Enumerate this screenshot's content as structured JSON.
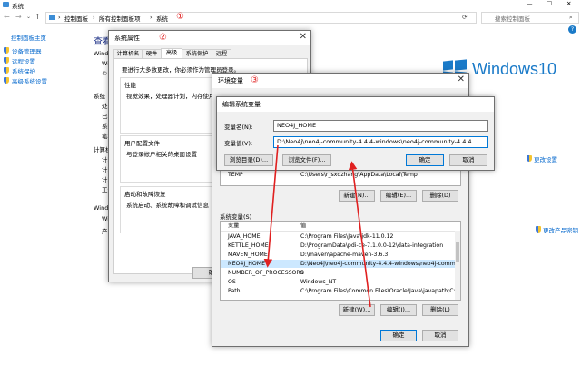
{
  "explorer": {
    "title": "系统",
    "controls": {
      "min": "—",
      "max": "☐",
      "close": "✕"
    },
    "breadcrumb": [
      "控制面板",
      "所有控制面板项",
      "系统"
    ],
    "breadcrumb_sep": "›",
    "annotation": "①",
    "search_placeholder": "搜索控制面板",
    "sidebar": {
      "home": "控制面板主页",
      "items": [
        "设备管理器",
        "远程设置",
        "系统保护",
        "高级系统设置"
      ]
    },
    "main_heading": "查看有关",
    "partial_labels": {
      "windows": "Windo",
      "win1": "Win",
      "win2": "©",
      "system": "系统",
      "sys1": "处理",
      "sys2": "已安",
      "sys3": "系统",
      "sys4": "笔和",
      "computer": "计算机",
      "comp1": "计算",
      "comp2": "计算",
      "comp3": "计算",
      "comp4": "工作",
      "winact": "Windo",
      "winact1": "Win",
      "winact2": "产品"
    },
    "brand": "Windows10",
    "change_settings": "更改设置",
    "change_key": "更改产品密钥",
    "help_icon": "?"
  },
  "sysprops": {
    "title": "系统属性",
    "annotation": "②",
    "tabs": [
      "计算机名",
      "硬件",
      "高级",
      "系统保护",
      "远程"
    ],
    "active_tab": 2,
    "admin_note": "要进行大多数更改，你必须作为管理员登录。",
    "performance": {
      "title": "性能",
      "desc": "视觉效果，处理器计划，内存使用，以"
    },
    "profiles": {
      "title": "用户配置文件",
      "desc": "与登录帐户相关的桌面设置"
    },
    "startup": {
      "title": "启动和故障恢复",
      "desc": "系统启动、系统故障和调试信息"
    },
    "partial_button": "确"
  },
  "envvars": {
    "title": "环境变量",
    "annotation": "③",
    "user_row": {
      "name": "TEMP",
      "value": "C:\\Users\\r_sxdzhang\\AppData\\Local\\Temp"
    },
    "user_buttons": [
      "新建(N)...",
      "编辑(E)...",
      "删除(D)"
    ],
    "system_section": "系统变量(S)",
    "columns": [
      "变量",
      "值"
    ],
    "system_rows": [
      {
        "name": "JAVA_HOME",
        "value": "C:\\Program Files\\Java\\jdk-11.0.12"
      },
      {
        "name": "KETTLE_HOME",
        "value": "D:\\ProgramData\\pdi-ce-7.1.0.0-12\\data-integration"
      },
      {
        "name": "MAVEN_HOME",
        "value": "D:\\maven\\apache-maven-3.6.3"
      },
      {
        "name": "NEO4J_HOME",
        "value": "D:\\Neo4j\\neo4j-community-4.4.4-windows\\neo4j-community-..."
      },
      {
        "name": "NUMBER_OF_PROCESSORS",
        "value": "8"
      },
      {
        "name": "OS",
        "value": "Windows_NT"
      },
      {
        "name": "Path",
        "value": "C:\\Program Files\\Common Files\\Oracle\\Java\\javapath;C:\\Prog..."
      }
    ],
    "selected_row": 3,
    "system_buttons": [
      "新建(W)...",
      "编辑(I)...",
      "删除(L)"
    ],
    "ok": "确定",
    "cancel": "取消"
  },
  "editdlg": {
    "title": "编辑系统变量",
    "name_label": "变量名(N):",
    "name_value": "NEO4J_HOME",
    "value_label": "变量值(V):",
    "value_value": "D:\\Neo4j\\neo4j-community-4.4.4-windows\\neo4j-community-4.4.4",
    "browse_dir": "浏览目录(D)...",
    "browse_file": "浏览文件(F)...",
    "ok": "确定",
    "cancel": "取消"
  },
  "colors": {
    "accent": "#0078d7",
    "annotation": "#e02020",
    "link": "#0066cc",
    "brand": "#1a7ac8",
    "selection": "#cce8ff"
  }
}
